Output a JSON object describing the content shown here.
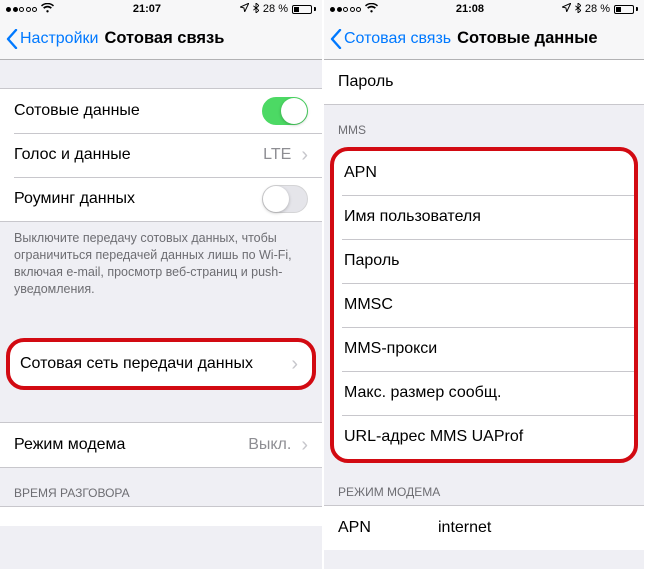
{
  "left": {
    "status": {
      "time": "21:07",
      "battery": "28 %",
      "signal_filled": 2,
      "signal_total": 5
    },
    "nav": {
      "back": "Настройки",
      "title": "Сотовая связь"
    },
    "rows": {
      "cellular_data": "Сотовые данные",
      "voice_data": {
        "label": "Голос и данные",
        "value": "LTE"
      },
      "roaming": "Роуминг данных",
      "network": "Сотовая сеть передачи данных",
      "hotspot": {
        "label": "Режим модема",
        "value": "Выкл."
      }
    },
    "footnote": "Выключите передачу сотовых данных, чтобы ограничиться передачей данных лишь по Wi-Fi, включая e-mail, просмотр веб-страниц и push-уведомления.",
    "section_call_time": "ВРЕМЯ РАЗГОВОРА"
  },
  "right": {
    "status": {
      "time": "21:08",
      "battery": "28 %",
      "signal_filled": 2,
      "signal_total": 5
    },
    "nav": {
      "back": "Сотовая связь",
      "title": "Сотовые данные"
    },
    "top_row": "Пароль",
    "section_mms": "MMS",
    "mms_fields": {
      "apn": "APN",
      "user": "Имя пользователя",
      "pass": "Пароль",
      "mmsc": "MMSC",
      "proxy": "MMS-прокси",
      "size": "Макс. размер сообщ.",
      "uaprof": "URL-адрес MMS UAProf"
    },
    "section_hotspot": "РЕЖИМ МОДЕМА",
    "hotspot": {
      "label": "APN",
      "value": "internet"
    }
  }
}
